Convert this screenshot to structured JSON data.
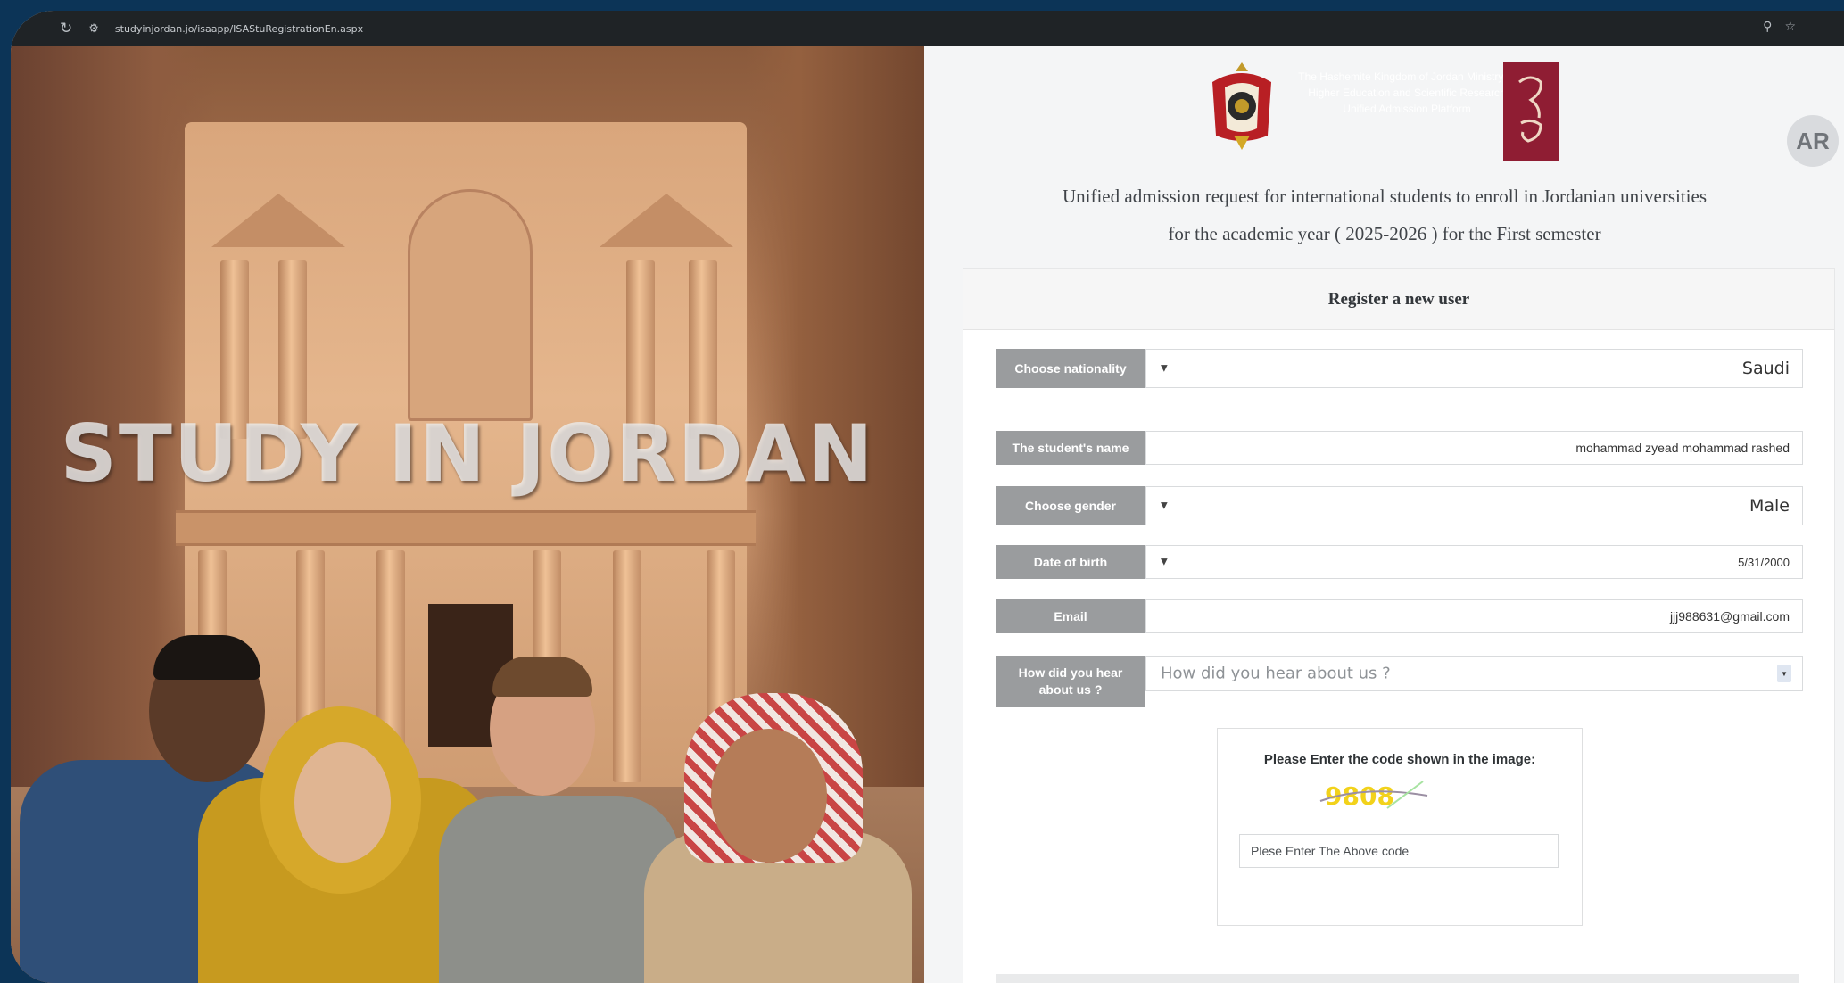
{
  "browser": {
    "reload_icon": "reload-icon",
    "site_info_icon": "site-settings-icon",
    "url": "studyinjordan.jo/isaapp/ISAStuRegistrationEn.aspx",
    "zoom_icon": "zoom-icon",
    "bookmark_icon": "star-icon"
  },
  "hero": {
    "title": "STUDY IN JORDAN"
  },
  "header": {
    "crest_text": "The Hashemite Kingdom of Jordan Ministry of Higher Education and Scientific Research Unified Admission Platform",
    "language_button": "AR",
    "headline_line1": "Unified admission request for international students to enroll in Jordanian universities",
    "headline_line2": "for the academic year ( 2025-2026 ) for the First semester"
  },
  "form": {
    "title": "Register a new user",
    "nationality": {
      "label": "Choose nationality",
      "value": "Saudi"
    },
    "name": {
      "label": "The student's name",
      "value": "mohammad zyead mohammad rashed"
    },
    "gender": {
      "label": "Choose gender",
      "value": "Male"
    },
    "dob": {
      "label": "Date of birth",
      "value": "5/31/2000"
    },
    "email": {
      "label": "Email",
      "value": "jjj988631@gmail.com"
    },
    "source": {
      "label": "How did you hear about us ?",
      "placeholder": "How did you hear about us ?"
    },
    "captcha": {
      "label": "Please Enter the code shown in the image:",
      "code": "9808",
      "input_placeholder": "Plese Enter The Above code"
    }
  },
  "colors": {
    "background": "#0c3457",
    "label_gray": "#9a9c9e",
    "crest_red": "#8f1d33",
    "captcha_yellow": "#f2d21b"
  }
}
